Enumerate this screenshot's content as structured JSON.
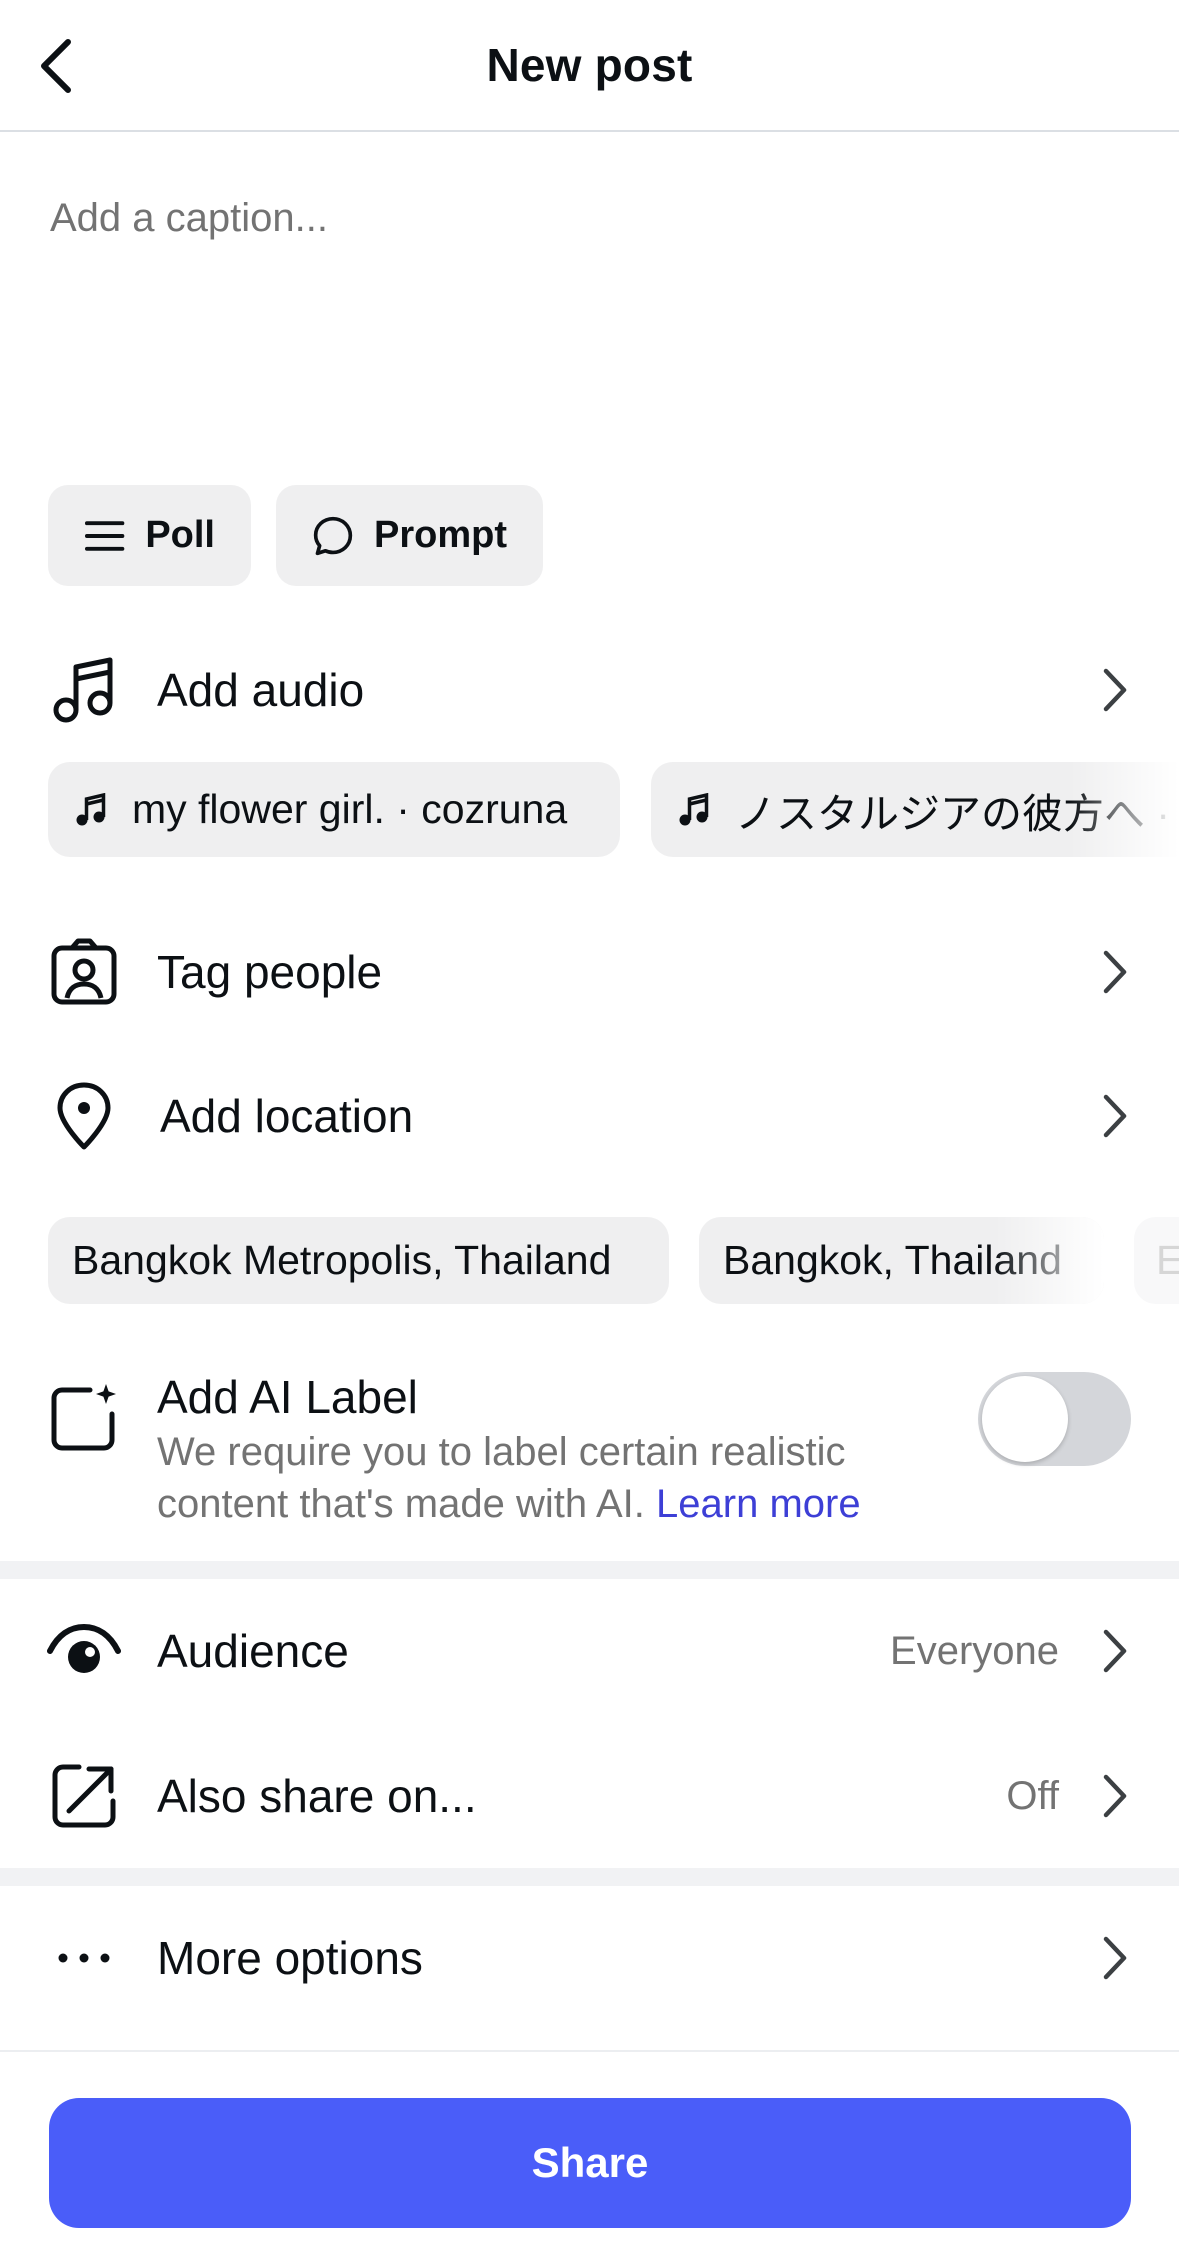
{
  "header": {
    "title": "New post",
    "back_icon": "chevron-left-icon"
  },
  "caption": {
    "placeholder": "Add a caption...",
    "value": ""
  },
  "quick_actions": [
    {
      "label": "Poll",
      "icon": "list-icon"
    },
    {
      "label": "Prompt",
      "icon": "speech-bubble-icon"
    }
  ],
  "audio": {
    "label": "Add audio",
    "icon": "music-note-icon",
    "suggestions": [
      "my flower girl. · cozruna",
      "ノスタルジアの彼方へ ·"
    ]
  },
  "tag_people": {
    "label": "Tag people",
    "icon": "tag-person-icon"
  },
  "location": {
    "label": "Add location",
    "icon": "location-pin-icon",
    "suggestions": [
      "Bangkok Metropolis, Thailand",
      "Bangkok, Thailand",
      "E"
    ]
  },
  "ai_label": {
    "title": "Add AI Label",
    "description": "We require you to label certain realistic content that's made with AI.",
    "link": "Learn more",
    "enabled": false
  },
  "audience": {
    "label": "Audience",
    "value": "Everyone",
    "icon": "eye-icon"
  },
  "also_share": {
    "label": "Also share on...",
    "value": "Off",
    "icon": "share-out-icon"
  },
  "more_options": {
    "label": "More options",
    "icon": "more-dots-icon"
  },
  "share_button": {
    "label": "Share"
  },
  "colors": {
    "accent": "#4a5df9",
    "link": "#3d3fd6",
    "chip_bg": "#efeff0",
    "secondary_text": "#737373"
  }
}
